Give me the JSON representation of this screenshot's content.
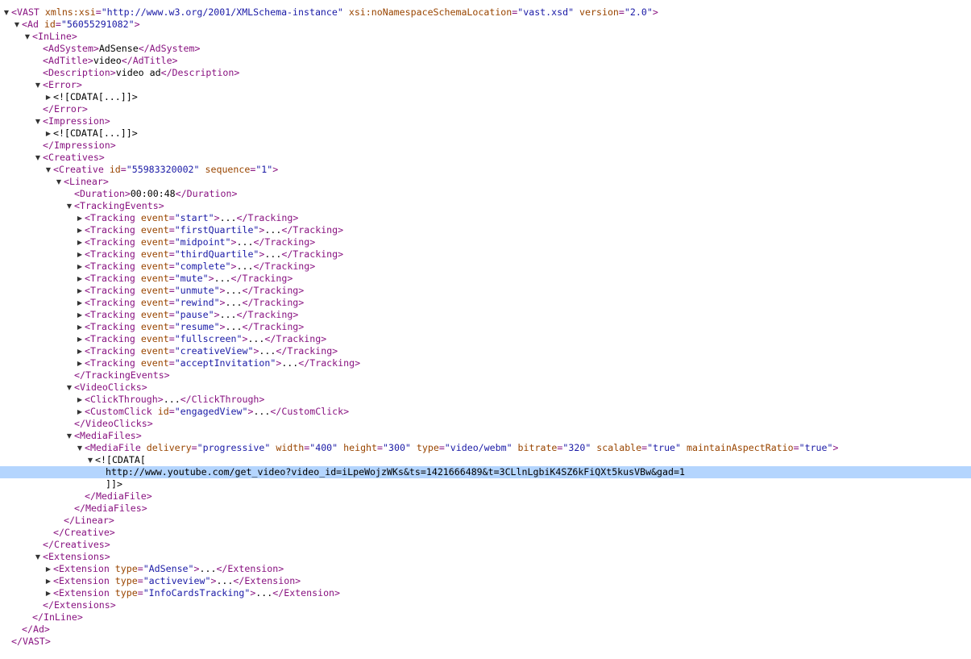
{
  "toggles": {
    "expanded": "▼",
    "collapsed": "▶"
  },
  "colors": {
    "tag": "#881280",
    "attribute": "#994500",
    "value": "#1a1aa6",
    "text": "#000000",
    "selection": "#b4d5fe"
  },
  "lines": [
    {
      "d": 0,
      "t": "e",
      "s": [
        [
          "tag",
          "<VAST "
        ],
        [
          "attr",
          "xmlns:xsi"
        ],
        [
          "tag",
          "="
        ],
        [
          "val",
          "\"http://www.w3.org/2001/XMLSchema-instance\""
        ],
        [
          "tag",
          " "
        ],
        [
          "attr",
          "xsi:noNamespaceSchemaLocation"
        ],
        [
          "tag",
          "="
        ],
        [
          "val",
          "\"vast.xsd\""
        ],
        [
          "tag",
          " "
        ],
        [
          "attr",
          "version"
        ],
        [
          "tag",
          "="
        ],
        [
          "val",
          "\"2.0\""
        ],
        [
          "tag",
          ">"
        ]
      ]
    },
    {
      "d": 1,
      "t": "e",
      "s": [
        [
          "tag",
          "<Ad "
        ],
        [
          "attr",
          "id"
        ],
        [
          "tag",
          "="
        ],
        [
          "val",
          "\"56055291082\""
        ],
        [
          "tag",
          ">"
        ]
      ]
    },
    {
      "d": 2,
      "t": "e",
      "s": [
        [
          "tag",
          "<InLine>"
        ]
      ]
    },
    {
      "d": 3,
      "t": "",
      "s": [
        [
          "tag",
          "<AdSystem>"
        ],
        [
          "txt",
          "AdSense"
        ],
        [
          "tag",
          "</AdSystem>"
        ]
      ]
    },
    {
      "d": 3,
      "t": "",
      "s": [
        [
          "tag",
          "<AdTitle>"
        ],
        [
          "txt",
          "video"
        ],
        [
          "tag",
          "</AdTitle>"
        ]
      ]
    },
    {
      "d": 3,
      "t": "",
      "s": [
        [
          "tag",
          "<Description>"
        ],
        [
          "txt",
          "video ad"
        ],
        [
          "tag",
          "</Description>"
        ]
      ]
    },
    {
      "d": 3,
      "t": "e",
      "s": [
        [
          "tag",
          "<Error>"
        ]
      ]
    },
    {
      "d": 4,
      "t": "c",
      "s": [
        [
          "txt",
          "<![CDATA[...]]>"
        ]
      ]
    },
    {
      "d": 3,
      "t": "",
      "s": [
        [
          "tag",
          "</Error>"
        ]
      ]
    },
    {
      "d": 3,
      "t": "e",
      "s": [
        [
          "tag",
          "<Impression>"
        ]
      ]
    },
    {
      "d": 4,
      "t": "c",
      "s": [
        [
          "txt",
          "<![CDATA[...]]>"
        ]
      ]
    },
    {
      "d": 3,
      "t": "",
      "s": [
        [
          "tag",
          "</Impression>"
        ]
      ]
    },
    {
      "d": 3,
      "t": "e",
      "s": [
        [
          "tag",
          "<Creatives>"
        ]
      ]
    },
    {
      "d": 4,
      "t": "e",
      "s": [
        [
          "tag",
          "<Creative "
        ],
        [
          "attr",
          "id"
        ],
        [
          "tag",
          "="
        ],
        [
          "val",
          "\"55983320002\""
        ],
        [
          "tag",
          " "
        ],
        [
          "attr",
          "sequence"
        ],
        [
          "tag",
          "="
        ],
        [
          "val",
          "\"1\""
        ],
        [
          "tag",
          ">"
        ]
      ]
    },
    {
      "d": 5,
      "t": "e",
      "s": [
        [
          "tag",
          "<Linear>"
        ]
      ]
    },
    {
      "d": 6,
      "t": "",
      "s": [
        [
          "tag",
          "<Duration>"
        ],
        [
          "txt",
          "00:00:48"
        ],
        [
          "tag",
          "</Duration>"
        ]
      ]
    },
    {
      "d": 6,
      "t": "e",
      "s": [
        [
          "tag",
          "<TrackingEvents>"
        ]
      ]
    },
    {
      "d": 7,
      "t": "c",
      "s": [
        [
          "tag",
          "<Tracking "
        ],
        [
          "attr",
          "event"
        ],
        [
          "tag",
          "="
        ],
        [
          "val",
          "\"start\""
        ],
        [
          "tag",
          ">"
        ],
        [
          "txt",
          "..."
        ],
        [
          "tag",
          "</Tracking>"
        ]
      ]
    },
    {
      "d": 7,
      "t": "c",
      "s": [
        [
          "tag",
          "<Tracking "
        ],
        [
          "attr",
          "event"
        ],
        [
          "tag",
          "="
        ],
        [
          "val",
          "\"firstQuartile\""
        ],
        [
          "tag",
          ">"
        ],
        [
          "txt",
          "..."
        ],
        [
          "tag",
          "</Tracking>"
        ]
      ]
    },
    {
      "d": 7,
      "t": "c",
      "s": [
        [
          "tag",
          "<Tracking "
        ],
        [
          "attr",
          "event"
        ],
        [
          "tag",
          "="
        ],
        [
          "val",
          "\"midpoint\""
        ],
        [
          "tag",
          ">"
        ],
        [
          "txt",
          "..."
        ],
        [
          "tag",
          "</Tracking>"
        ]
      ]
    },
    {
      "d": 7,
      "t": "c",
      "s": [
        [
          "tag",
          "<Tracking "
        ],
        [
          "attr",
          "event"
        ],
        [
          "tag",
          "="
        ],
        [
          "val",
          "\"thirdQuartile\""
        ],
        [
          "tag",
          ">"
        ],
        [
          "txt",
          "..."
        ],
        [
          "tag",
          "</Tracking>"
        ]
      ]
    },
    {
      "d": 7,
      "t": "c",
      "s": [
        [
          "tag",
          "<Tracking "
        ],
        [
          "attr",
          "event"
        ],
        [
          "tag",
          "="
        ],
        [
          "val",
          "\"complete\""
        ],
        [
          "tag",
          ">"
        ],
        [
          "txt",
          "..."
        ],
        [
          "tag",
          "</Tracking>"
        ]
      ]
    },
    {
      "d": 7,
      "t": "c",
      "s": [
        [
          "tag",
          "<Tracking "
        ],
        [
          "attr",
          "event"
        ],
        [
          "tag",
          "="
        ],
        [
          "val",
          "\"mute\""
        ],
        [
          "tag",
          ">"
        ],
        [
          "txt",
          "..."
        ],
        [
          "tag",
          "</Tracking>"
        ]
      ]
    },
    {
      "d": 7,
      "t": "c",
      "s": [
        [
          "tag",
          "<Tracking "
        ],
        [
          "attr",
          "event"
        ],
        [
          "tag",
          "="
        ],
        [
          "val",
          "\"unmute\""
        ],
        [
          "tag",
          ">"
        ],
        [
          "txt",
          "..."
        ],
        [
          "tag",
          "</Tracking>"
        ]
      ]
    },
    {
      "d": 7,
      "t": "c",
      "s": [
        [
          "tag",
          "<Tracking "
        ],
        [
          "attr",
          "event"
        ],
        [
          "tag",
          "="
        ],
        [
          "val",
          "\"rewind\""
        ],
        [
          "tag",
          ">"
        ],
        [
          "txt",
          "..."
        ],
        [
          "tag",
          "</Tracking>"
        ]
      ]
    },
    {
      "d": 7,
      "t": "c",
      "s": [
        [
          "tag",
          "<Tracking "
        ],
        [
          "attr",
          "event"
        ],
        [
          "tag",
          "="
        ],
        [
          "val",
          "\"pause\""
        ],
        [
          "tag",
          ">"
        ],
        [
          "txt",
          "..."
        ],
        [
          "tag",
          "</Tracking>"
        ]
      ]
    },
    {
      "d": 7,
      "t": "c",
      "s": [
        [
          "tag",
          "<Tracking "
        ],
        [
          "attr",
          "event"
        ],
        [
          "tag",
          "="
        ],
        [
          "val",
          "\"resume\""
        ],
        [
          "tag",
          ">"
        ],
        [
          "txt",
          "..."
        ],
        [
          "tag",
          "</Tracking>"
        ]
      ]
    },
    {
      "d": 7,
      "t": "c",
      "s": [
        [
          "tag",
          "<Tracking "
        ],
        [
          "attr",
          "event"
        ],
        [
          "tag",
          "="
        ],
        [
          "val",
          "\"fullscreen\""
        ],
        [
          "tag",
          ">"
        ],
        [
          "txt",
          "..."
        ],
        [
          "tag",
          "</Tracking>"
        ]
      ]
    },
    {
      "d": 7,
      "t": "c",
      "s": [
        [
          "tag",
          "<Tracking "
        ],
        [
          "attr",
          "event"
        ],
        [
          "tag",
          "="
        ],
        [
          "val",
          "\"creativeView\""
        ],
        [
          "tag",
          ">"
        ],
        [
          "txt",
          "..."
        ],
        [
          "tag",
          "</Tracking>"
        ]
      ]
    },
    {
      "d": 7,
      "t": "c",
      "s": [
        [
          "tag",
          "<Tracking "
        ],
        [
          "attr",
          "event"
        ],
        [
          "tag",
          "="
        ],
        [
          "val",
          "\"acceptInvitation\""
        ],
        [
          "tag",
          ">"
        ],
        [
          "txt",
          "..."
        ],
        [
          "tag",
          "</Tracking>"
        ]
      ]
    },
    {
      "d": 6,
      "t": "",
      "s": [
        [
          "tag",
          "</TrackingEvents>"
        ]
      ]
    },
    {
      "d": 6,
      "t": "e",
      "s": [
        [
          "tag",
          "<VideoClicks>"
        ]
      ]
    },
    {
      "d": 7,
      "t": "c",
      "s": [
        [
          "tag",
          "<ClickThrough>"
        ],
        [
          "txt",
          "..."
        ],
        [
          "tag",
          "</ClickThrough>"
        ]
      ]
    },
    {
      "d": 7,
      "t": "c",
      "s": [
        [
          "tag",
          "<CustomClick "
        ],
        [
          "attr",
          "id"
        ],
        [
          "tag",
          "="
        ],
        [
          "val",
          "\"engagedView\""
        ],
        [
          "tag",
          ">"
        ],
        [
          "txt",
          "..."
        ],
        [
          "tag",
          "</CustomClick>"
        ]
      ]
    },
    {
      "d": 6,
      "t": "",
      "s": [
        [
          "tag",
          "</VideoClicks>"
        ]
      ]
    },
    {
      "d": 6,
      "t": "e",
      "s": [
        [
          "tag",
          "<MediaFiles>"
        ]
      ]
    },
    {
      "d": 7,
      "t": "e",
      "s": [
        [
          "tag",
          "<MediaFile "
        ],
        [
          "attr",
          "delivery"
        ],
        [
          "tag",
          "="
        ],
        [
          "val",
          "\"progressive\""
        ],
        [
          "tag",
          " "
        ],
        [
          "attr",
          "width"
        ],
        [
          "tag",
          "="
        ],
        [
          "val",
          "\"400\""
        ],
        [
          "tag",
          " "
        ],
        [
          "attr",
          "height"
        ],
        [
          "tag",
          "="
        ],
        [
          "val",
          "\"300\""
        ],
        [
          "tag",
          " "
        ],
        [
          "attr",
          "type"
        ],
        [
          "tag",
          "="
        ],
        [
          "val",
          "\"video/webm\""
        ],
        [
          "tag",
          " "
        ],
        [
          "attr",
          "bitrate"
        ],
        [
          "tag",
          "="
        ],
        [
          "val",
          "\"320\""
        ],
        [
          "tag",
          " "
        ],
        [
          "attr",
          "scalable"
        ],
        [
          "tag",
          "="
        ],
        [
          "val",
          "\"true\""
        ],
        [
          "tag",
          " "
        ],
        [
          "attr",
          "maintainAspectRatio"
        ],
        [
          "tag",
          "="
        ],
        [
          "val",
          "\"true\""
        ],
        [
          "tag",
          ">"
        ]
      ]
    },
    {
      "d": 8,
      "t": "e",
      "s": [
        [
          "txt",
          "<![CDATA["
        ]
      ]
    },
    {
      "d": 9,
      "t": "",
      "sel": true,
      "s": [
        [
          "txt",
          "http://www.youtube.com/get_video?video_id=iLpeWojzWKs&ts=1421666489&t=3CLlnLgbiK4SZ6kFiQXt5kusVBw&gad=1"
        ]
      ]
    },
    {
      "d": 9,
      "t": "",
      "s": [
        [
          "txt",
          "]]>"
        ]
      ]
    },
    {
      "d": 7,
      "t": "",
      "s": [
        [
          "tag",
          "</MediaFile>"
        ]
      ]
    },
    {
      "d": 6,
      "t": "",
      "s": [
        [
          "tag",
          "</MediaFiles>"
        ]
      ]
    },
    {
      "d": 5,
      "t": "",
      "s": [
        [
          "tag",
          "</Linear>"
        ]
      ]
    },
    {
      "d": 4,
      "t": "",
      "s": [
        [
          "tag",
          "</Creative>"
        ]
      ]
    },
    {
      "d": 3,
      "t": "",
      "s": [
        [
          "tag",
          "</Creatives>"
        ]
      ]
    },
    {
      "d": 3,
      "t": "e",
      "s": [
        [
          "tag",
          "<Extensions>"
        ]
      ]
    },
    {
      "d": 4,
      "t": "c",
      "s": [
        [
          "tag",
          "<Extension "
        ],
        [
          "attr",
          "type"
        ],
        [
          "tag",
          "="
        ],
        [
          "val",
          "\"AdSense\""
        ],
        [
          "tag",
          ">"
        ],
        [
          "txt",
          "..."
        ],
        [
          "tag",
          "</Extension>"
        ]
      ]
    },
    {
      "d": 4,
      "t": "c",
      "s": [
        [
          "tag",
          "<Extension "
        ],
        [
          "attr",
          "type"
        ],
        [
          "tag",
          "="
        ],
        [
          "val",
          "\"activeview\""
        ],
        [
          "tag",
          ">"
        ],
        [
          "txt",
          "..."
        ],
        [
          "tag",
          "</Extension>"
        ]
      ]
    },
    {
      "d": 4,
      "t": "c",
      "s": [
        [
          "tag",
          "<Extension "
        ],
        [
          "attr",
          "type"
        ],
        [
          "tag",
          "="
        ],
        [
          "val",
          "\"InfoCardsTracking\""
        ],
        [
          "tag",
          ">"
        ],
        [
          "txt",
          "..."
        ],
        [
          "tag",
          "</Extension>"
        ]
      ]
    },
    {
      "d": 3,
      "t": "",
      "s": [
        [
          "tag",
          "</Extensions>"
        ]
      ]
    },
    {
      "d": 2,
      "t": "",
      "s": [
        [
          "tag",
          "</InLine>"
        ]
      ]
    },
    {
      "d": 1,
      "t": "",
      "s": [
        [
          "tag",
          "</Ad>"
        ]
      ]
    },
    {
      "d": 0,
      "t": "",
      "s": [
        [
          "tag",
          "</VAST>"
        ]
      ]
    }
  ]
}
